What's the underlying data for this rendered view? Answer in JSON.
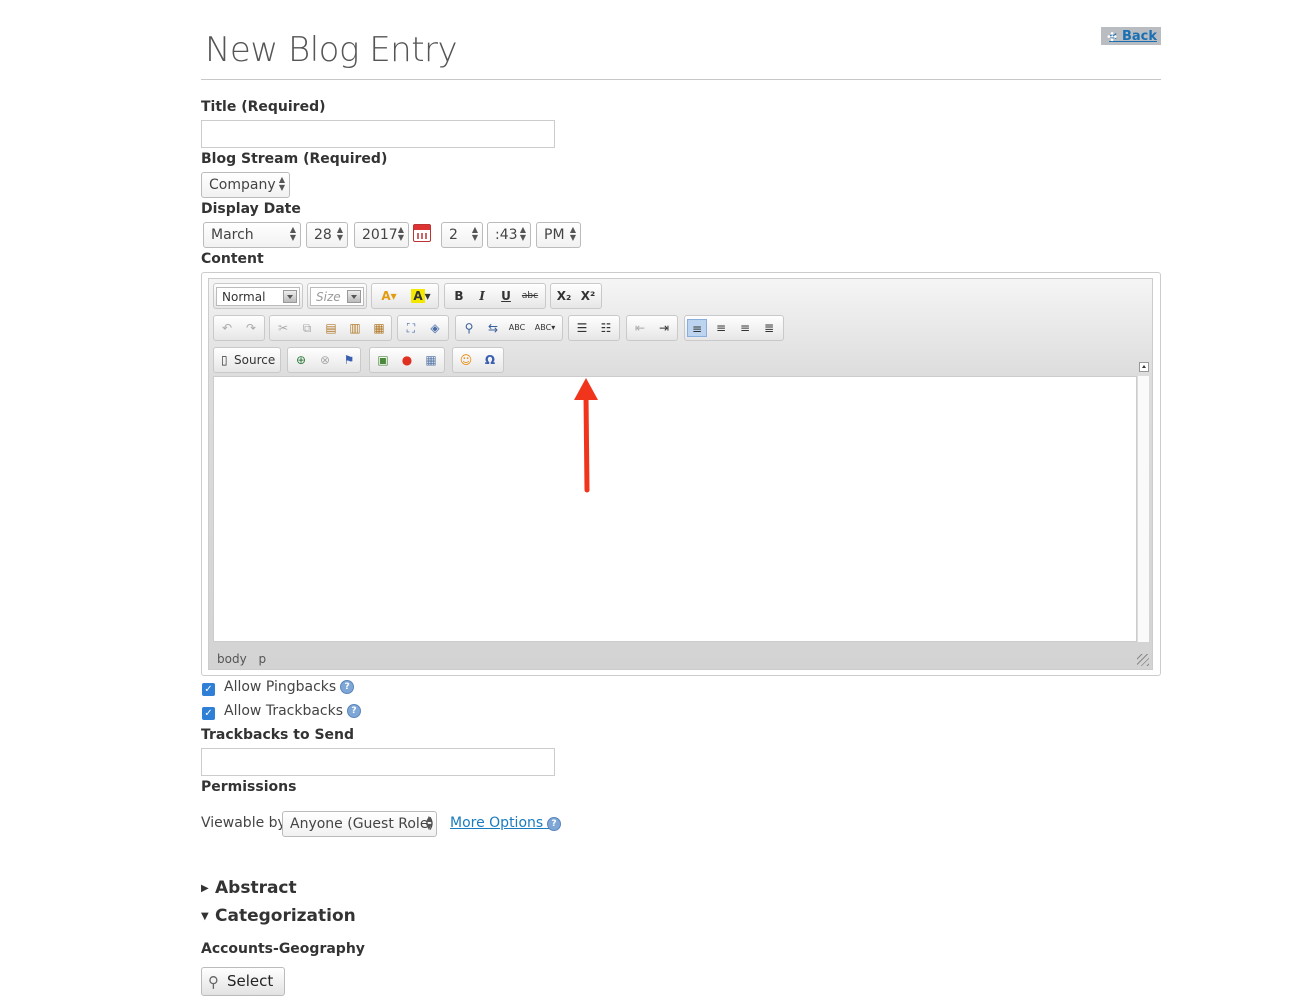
{
  "header": {
    "title": "New Blog Entry",
    "back_label": "« Back",
    "move_glyph": "✣"
  },
  "form": {
    "title_label": "Title (Required)",
    "title_value": "",
    "blog_stream_label": "Blog Stream (Required)",
    "blog_stream_value": "Company",
    "display_date_label": "Display Date",
    "month": "March",
    "day": "28",
    "year": "2017",
    "hour": "2",
    "minute": ":43",
    "ampm": "PM",
    "content_label": "Content",
    "allow_pingbacks_label": "Allow Pingbacks",
    "allow_pingbacks_checked": true,
    "allow_trackbacks_label": "Allow Trackbacks",
    "allow_trackbacks_checked": true,
    "trackbacks_label": "Trackbacks to Send",
    "trackbacks_value": "",
    "permissions_label": "Permissions",
    "viewable_by_label": "Viewable by",
    "viewable_by_value": "Anyone (Guest Role)",
    "more_options_label": "More Options »"
  },
  "editor": {
    "format_combo": "Normal",
    "size_combo": "Size",
    "source_label": "Source",
    "path": [
      "body",
      "p"
    ],
    "toolbar_icons": {
      "font-color": "A",
      "bg-color": "A",
      "bold": "B",
      "italic": "I",
      "underline": "U",
      "strike": "abc",
      "subscript": "X₂",
      "superscript": "X²"
    }
  },
  "sections": {
    "abstract_label": "Abstract",
    "abstract_tri": "▶",
    "categorization_label": "Categorization",
    "categorization_tri": "▼",
    "accounts_geo_label": "Accounts-Geography",
    "select_label": "Select"
  },
  "colors": {
    "accent": "#2f7fd6",
    "link": "#1a7cc0",
    "annotation_arrow": "#f0351c"
  }
}
